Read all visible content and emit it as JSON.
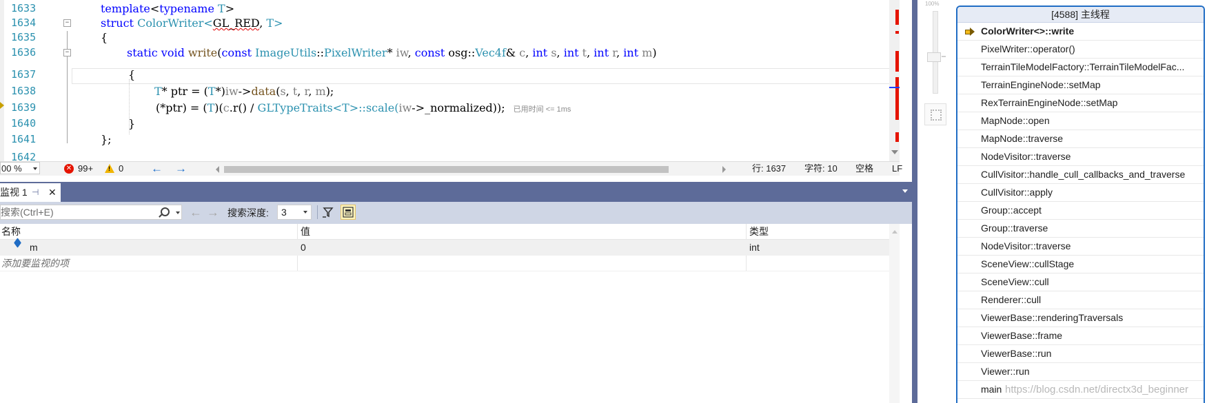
{
  "editor": {
    "lines": [
      {
        "num": "1633"
      },
      {
        "num": "1634"
      },
      {
        "num": "1635"
      },
      {
        "num": "1636"
      },
      {
        "num": "1637"
      },
      {
        "num": "1638"
      },
      {
        "num": "1639"
      },
      {
        "num": "1640"
      },
      {
        "num": "1641"
      },
      {
        "num": "1642"
      }
    ],
    "code": {
      "l1633_kw": "template",
      "l1633_rest": "<",
      "l1633_kw2": "typename",
      "l1633_tp": "T",
      "l1633_end": ">",
      "l1634_kw": "struct",
      "l1634_ty": "ColorWriter",
      "l1634_lt": "<",
      "l1634_sq": "GL_RED",
      "l1634_comma": ", ",
      "l1634_tp": "T",
      "l1634_gt": ">",
      "l1635": "{",
      "l1636_kw1": "static",
      "l1636_kw2": "void",
      "l1636_fn": "write",
      "l1636_p1": "(",
      "l1636_kw3": "const",
      "l1636_ty1": "ImageUtils",
      "l1636_sep1": "::",
      "l1636_ty2": "PixelWriter",
      "l1636_star": "* ",
      "l1636_pm1": "iw",
      "l1636_c1": ", ",
      "l1636_kw4": "const",
      "l1636_ns": "osg",
      "l1636_sep2": "::",
      "l1636_ty3": "Vec4f",
      "l1636_amp": "& ",
      "l1636_pm2": "c",
      "l1636_c2": ", ",
      "l1636_kw5": "int",
      "l1636_pm3": "s",
      "l1636_c3": ", ",
      "l1636_kw6": "int",
      "l1636_pm4": "t",
      "l1636_c4": ", ",
      "l1636_kw7": "int",
      "l1636_pm5": "r",
      "l1636_c5": ", ",
      "l1636_kw8": "int",
      "l1636_pm6": "m",
      "l1636_end": ")",
      "l1637": "{",
      "l1638_tp1": "T",
      "l1638_a": "* ptr = (",
      "l1638_tp2": "T",
      "l1638_b": "*)",
      "l1638_pm1": "iw",
      "l1638_c": "->",
      "l1638_fn": "data",
      "l1638_d": "(",
      "l1638_pm2": "s",
      "l1638_e": ", ",
      "l1638_pm3": "t",
      "l1638_f": ", ",
      "l1638_pm4": "r",
      "l1638_g": ", ",
      "l1638_pm5": "m",
      "l1638_h": ");",
      "l1639_a": "(*ptr) = (",
      "l1639_tp1": "T",
      "l1639_b": ")(",
      "l1639_pm1": "c",
      "l1639_c": ".r() / ",
      "l1639_ty": "GLTypeTraits",
      "l1639_d": "<",
      "l1639_tp2": "T",
      "l1639_e": ">::scale(",
      "l1639_pm2": "iw",
      "l1639_f": "->_normalized));",
      "l1639_ghost": "已用时间 <= 1ms",
      "l1640": "}",
      "l1641": "};"
    }
  },
  "statusbar": {
    "zoom": "00 %",
    "errors": "99+",
    "warnings": "0",
    "line": "行: 1637",
    "char": "字符: 10",
    "whitespace": "空格",
    "eol": "LF"
  },
  "watch": {
    "tab_label": "监视 1",
    "search_placeholder": "搜索(Ctrl+E)",
    "depth_label": "搜索深度:",
    "depth_value": "3",
    "columns": {
      "name": "名称",
      "value": "值",
      "type": "类型"
    },
    "rows": [
      {
        "name": "m",
        "value": "0",
        "type": "int"
      }
    ],
    "add_item": "添加要监视的项"
  },
  "zoom_slider": {
    "label": "100%",
    "level_fraction": 0.5
  },
  "call_stack": {
    "title": "[4588] 主线程",
    "frames": [
      "ColorWriter<>::write",
      "PixelWriter::operator()",
      "TerrainTileModelFactory::TerrainTileModelFac...",
      "TerrainEngineNode::setMap",
      "RexTerrainEngineNode::setMap",
      "MapNode::open",
      "MapNode::traverse",
      "NodeVisitor::traverse",
      "CullVisitor::handle_cull_callbacks_and_traverse",
      "CullVisitor::apply",
      "Group::accept",
      "Group::traverse",
      "NodeVisitor::traverse",
      "SceneView::cullStage",
      "SceneView::cull",
      "Renderer::cull",
      "ViewerBase::renderingTraversals",
      "ViewerBase::frame",
      "ViewerBase::run",
      "Viewer::run",
      "main"
    ]
  },
  "watermark": "https://blog.csdn.net/directx3d_beginner",
  "colors": {
    "accent": "#1f6cc4",
    "panel_header": "#5d6b99",
    "error": "#e51400",
    "warning": "#f0b400"
  }
}
